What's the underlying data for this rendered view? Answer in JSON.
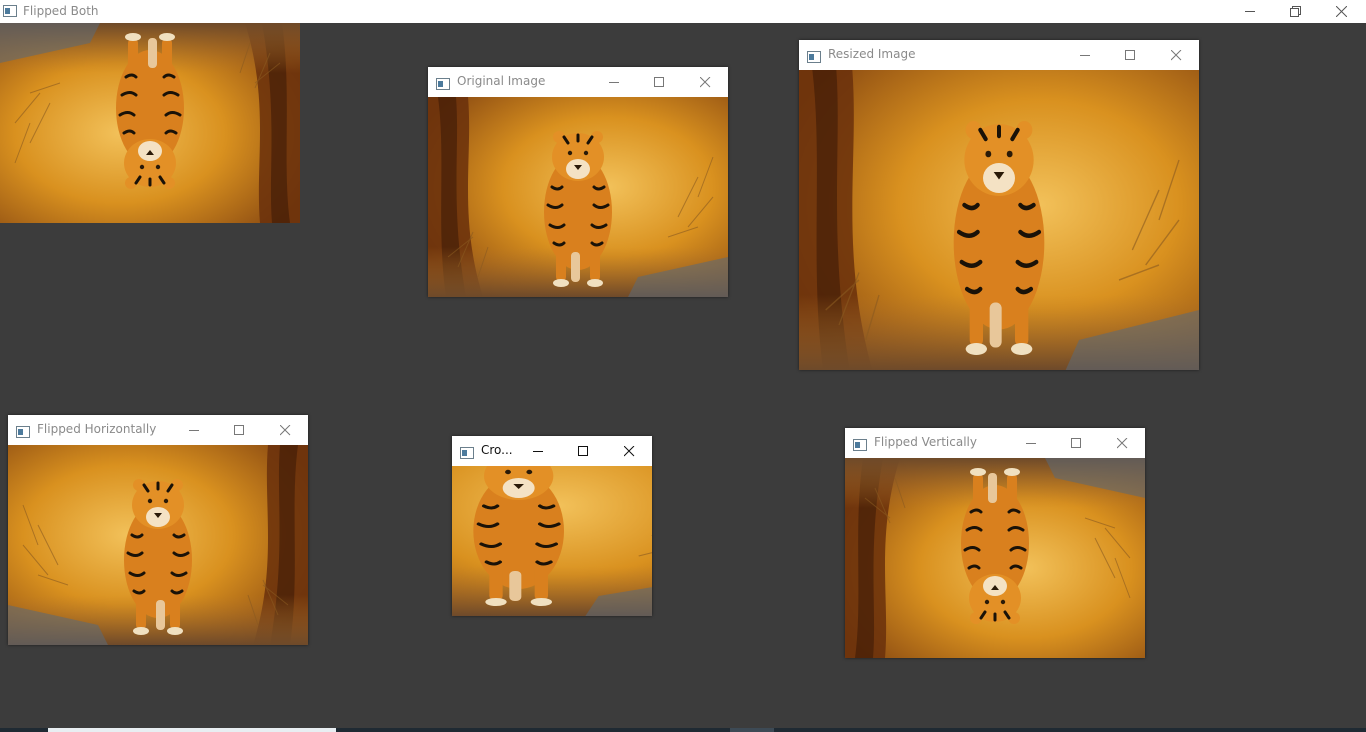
{
  "main_window": {
    "title": "Flipped Both",
    "icon": "app-window-icon"
  },
  "windows": {
    "original": {
      "title": "Original Image"
    },
    "resized": {
      "title": "Resized Image"
    },
    "flipped_horizontally": {
      "title": "Flipped Horizontally"
    },
    "cropped": {
      "title": "Cro..."
    },
    "flipped_vertically": {
      "title": "Flipped Vertically"
    }
  },
  "image": {
    "subject": "tiger",
    "accent": "#d58a1c",
    "bg_dark": "#6b3a10"
  },
  "theme": {
    "desktop_bg": "#3c3c3c",
    "titlebar_bg": "#ffffff",
    "inactive_title": "#8a8a8a"
  }
}
